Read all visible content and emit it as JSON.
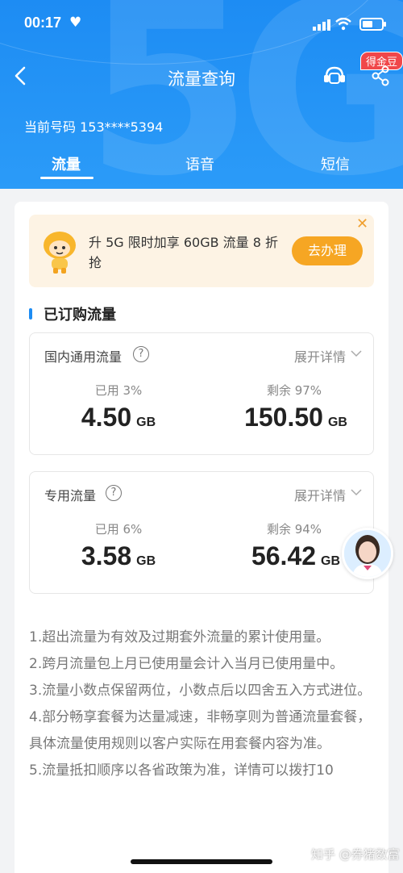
{
  "status_bar": {
    "time": "00:17"
  },
  "header": {
    "title": "流量查询",
    "badge": "得金豆",
    "phone_label": "当前号码 153****5394"
  },
  "tabs": [
    {
      "label": "流量",
      "active": true
    },
    {
      "label": "语音",
      "active": false
    },
    {
      "label": "短信",
      "active": false
    }
  ],
  "promo": {
    "text": "升 5G  限时加享 60GB 流量   8 折抢",
    "button": "去办理"
  },
  "section": {
    "title": "已订购流量"
  },
  "packages": [
    {
      "name": "国内通用流量",
      "expand_label": "展开详情",
      "used_label": "已用 3%",
      "used_value": "4.50",
      "used_unit": "GB",
      "remaining_label": "剩余 97%",
      "remaining_value": "150.50",
      "remaining_unit": "GB"
    },
    {
      "name": "专用流量",
      "expand_label": "展开详情",
      "used_label": "已用 6%",
      "used_value": "3.58",
      "used_unit": "GB",
      "remaining_label": "剩余 94%",
      "remaining_value": "56.42",
      "remaining_unit": "GB"
    }
  ],
  "notes": [
    "1.超出流量为有效及过期套外流量的累计使用量。",
    "2.跨月流量包上月已使用量会计入当月已使用量中。",
    "3.流量小数点保留两位，小数点后以四舍五入方式进位。",
    "4.部分畅享套餐为达量减速，非畅享则为普通流量套餐，具体流量使用规则以客户实际在用套餐内容为准。",
    "5.流量抵扣顺序以各省政策为准，详情可以拨打10"
  ],
  "watermark": "知乎 @券猪数富",
  "colors": {
    "primary": "#1d8cf3",
    "promo_bg": "#fdf3e4",
    "promo_button": "#f6a623",
    "badge": "#f0474a"
  }
}
